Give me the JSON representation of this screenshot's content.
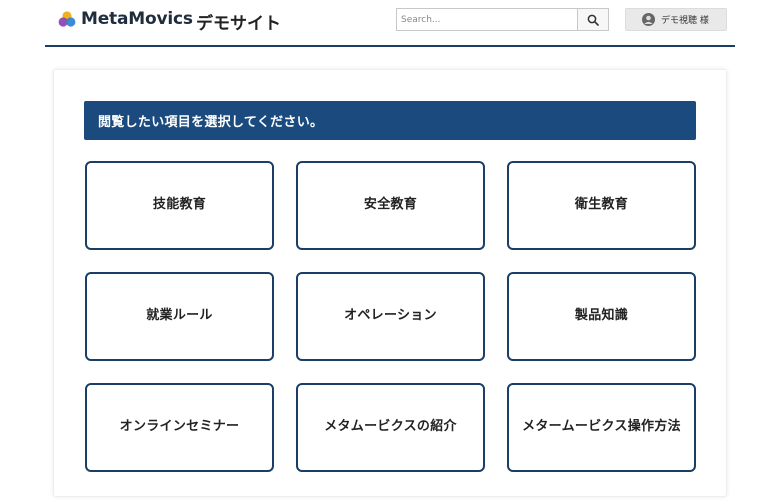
{
  "header": {
    "brand": "MetaMovics",
    "site_name": "デモサイト",
    "search": {
      "placeholder": "Search..."
    },
    "user": {
      "name": "デモ視聴 様"
    }
  },
  "main": {
    "banner": "閲覧したい項目を選択してください。",
    "categories": [
      {
        "label": "技能教育"
      },
      {
        "label": "安全教育"
      },
      {
        "label": "衛生教育"
      },
      {
        "label": "就業ルール"
      },
      {
        "label": "オペレーション"
      },
      {
        "label": "製品知識"
      },
      {
        "label": "オンラインセミナー"
      },
      {
        "label": "メタムービクスの紹介"
      },
      {
        "label": "メタームービクス操作方法"
      }
    ]
  },
  "colors": {
    "accent": "#1a4a7e",
    "rule": "#1a3e66",
    "card_border": "#1a3e66"
  },
  "icons": {
    "logo": "metamovics-logo-icon",
    "search": "search-icon",
    "user": "user-avatar-icon"
  }
}
